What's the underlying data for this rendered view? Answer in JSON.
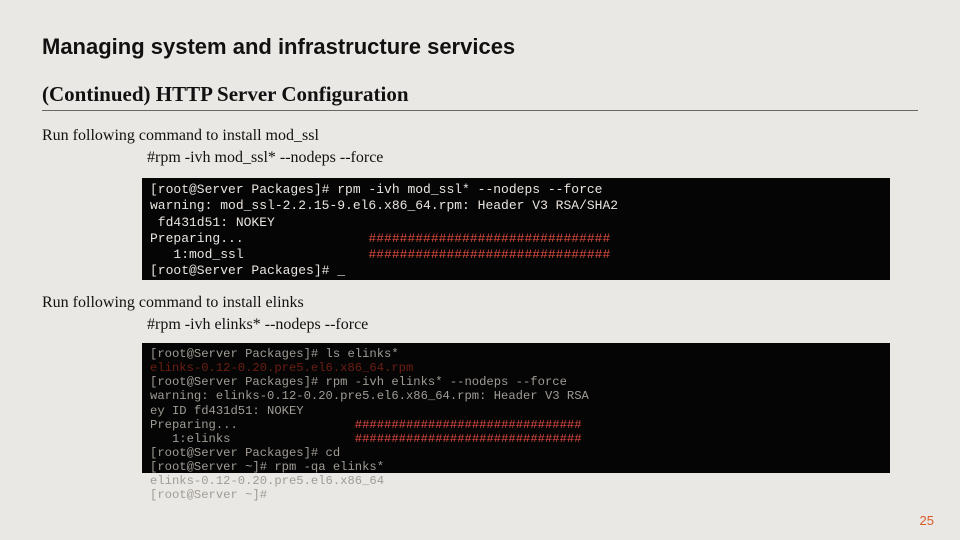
{
  "title": "Managing system and infrastructure services",
  "subtitle": "(Continued) HTTP Server Configuration",
  "section1": {
    "intro": "Run following command to install mod_ssl",
    "cmd": "#rpm -ivh mod_ssl* --nodeps --force"
  },
  "term1": {
    "l1": "[root@Server Packages]# rpm -ivh mod_ssl* --nodeps --force",
    "l2": "warning: mod_ssl-2.2.15-9.el6.x86_64.rpm: Header V3 RSA/SHA2",
    "l3": " fd431d51: NOKEY",
    "l4a": "Preparing...                ",
    "l4b": "###############################",
    "l5a": "   1:mod_ssl                ",
    "l5b": "###############################",
    "l6": "[root@Server Packages]# _"
  },
  "section2": {
    "intro": "Run following command to install elinks",
    "cmd": "#rpm -ivh elinks* --nodeps --force"
  },
  "term2": {
    "l1": "[root@Server Packages]# ls elinks*",
    "l2": "elinks-0.12-0.20.pre5.el6.x86_64.rpm",
    "l3": "[root@Server Packages]# rpm -ivh elinks* --nodeps --force",
    "l4": "warning: elinks-0.12-0.20.pre5.el6.x86_64.rpm: Header V3 RSA",
    "l5": "ey ID fd431d51: NOKEY",
    "l6a": "Preparing...                ",
    "l6b": "###############################",
    "l7a": "   1:elinks                 ",
    "l7b": "###############################",
    "l8": "[root@Server Packages]# cd",
    "l9": "[root@Server ~]# rpm -qa elinks*",
    "l10": "elinks-0.12-0.20.pre5.el6.x86_64",
    "l11": "[root@Server ~]# "
  },
  "page_number": "25"
}
